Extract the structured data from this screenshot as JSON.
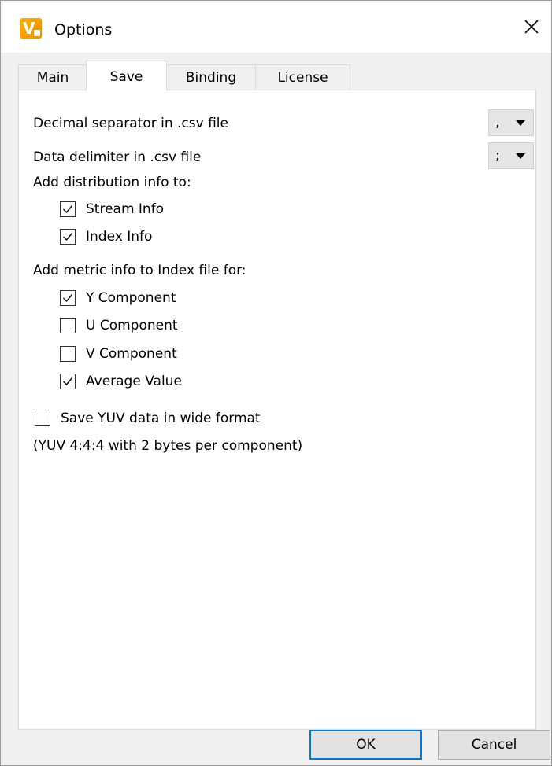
{
  "window": {
    "title": "Options",
    "app_icon_letter": "V"
  },
  "tabs": [
    {
      "label": "Main",
      "active": false
    },
    {
      "label": "Save",
      "active": true
    },
    {
      "label": "Binding",
      "active": false
    },
    {
      "label": "License",
      "active": false
    }
  ],
  "save_tab": {
    "decimal_separator": {
      "label": "Decimal separator in .csv file",
      "value": ","
    },
    "data_delimiter": {
      "label": "Data delimiter  in .csv file",
      "value": ";"
    },
    "distribution_heading": "Add distribution info to:",
    "distribution_options": [
      {
        "label": "Stream Info",
        "checked": true
      },
      {
        "label": "Index Info",
        "checked": true
      }
    ],
    "metric_heading": "Add metric info to Index file for:",
    "metric_options": [
      {
        "label": "Y Component",
        "checked": true
      },
      {
        "label": "U Component",
        "checked": false
      },
      {
        "label": "V Component",
        "checked": false
      },
      {
        "label": "Average Value",
        "checked": true
      }
    ],
    "wide_format": {
      "label": "Save YUV data in wide format",
      "checked": false
    },
    "wide_format_note": "(YUV 4:4:4 with 2 bytes per component)"
  },
  "buttons": {
    "ok": "OK",
    "cancel": "Cancel"
  },
  "icons": {
    "app": "app-logo-icon",
    "close": "close-icon",
    "dropdown": "chevron-down-icon",
    "check": "check-icon"
  },
  "colors": {
    "accent": "#0078d7",
    "app_icon": "#f59a00",
    "dialog_bg": "#f0f0f0",
    "panel_bg": "#ffffff"
  }
}
